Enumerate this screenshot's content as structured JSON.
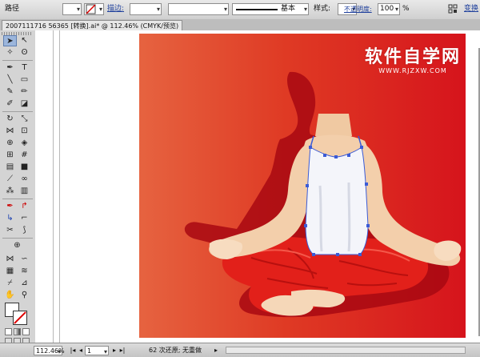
{
  "control_bar": {
    "object_type": "路径",
    "stroke_label": "描边:",
    "stroke_style": "基本",
    "style_label": "样式:",
    "opacity_label": "不透明度:",
    "opacity_value": "100",
    "opacity_unit": "%",
    "transform_label": "变换"
  },
  "document_tab": {
    "title": "2007111716 56365 [转换].ai* @ 112.46% (CMYK/预览)"
  },
  "watermark": {
    "line1": "软件自学网",
    "line2": "WWW.RJZXW.COM"
  },
  "status_bar": {
    "zoom": "112.46%",
    "artboard": "1",
    "status_text": "62 次还原; 无重做"
  },
  "colors": {
    "art_left": "#e66340",
    "art_right": "#d6141c",
    "selection": "#3b5bd6"
  }
}
